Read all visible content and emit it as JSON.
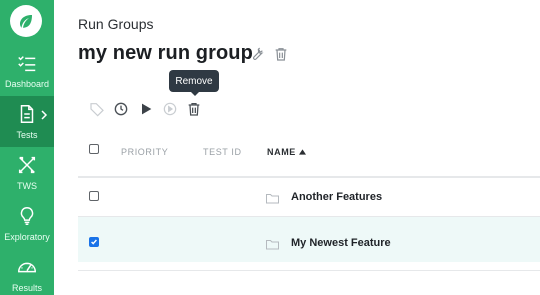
{
  "sidebar": {
    "logo_icon": "leaf-icon",
    "items": [
      {
        "label": "Dashboard",
        "icon": "checklist-icon",
        "active": false
      },
      {
        "label": "Tests",
        "icon": "document-icon",
        "active": true
      },
      {
        "label": "TWS",
        "icon": "tools-icon",
        "active": false
      },
      {
        "label": "Exploratory",
        "icon": "lightbulb-icon",
        "active": false
      },
      {
        "label": "Results",
        "icon": "gauge-icon",
        "active": false
      }
    ]
  },
  "header": {
    "breadcrumb": "Run Groups",
    "title": "my new run group",
    "title_actions": [
      "wrench-icon",
      "trash-icon"
    ]
  },
  "toolbar": {
    "icons": [
      "tag-icon",
      "clock-icon",
      "play-icon",
      "play-circle-icon",
      "trash-icon"
    ],
    "tooltip": "Remove"
  },
  "table": {
    "columns": [
      "PRIORITY",
      "TEST ID",
      "NAME"
    ],
    "rows": [
      {
        "name": "Another Features",
        "checked": false,
        "icon": "folder-icon"
      },
      {
        "name": "My Newest Feature",
        "checked": true,
        "icon": "folder-icon"
      }
    ]
  },
  "colors": {
    "sidebar": "#2eb06b",
    "sidebar_active": "#1f8c52",
    "selected_row": "#eef9f8",
    "checkbox_checked": "#1a73e8"
  }
}
